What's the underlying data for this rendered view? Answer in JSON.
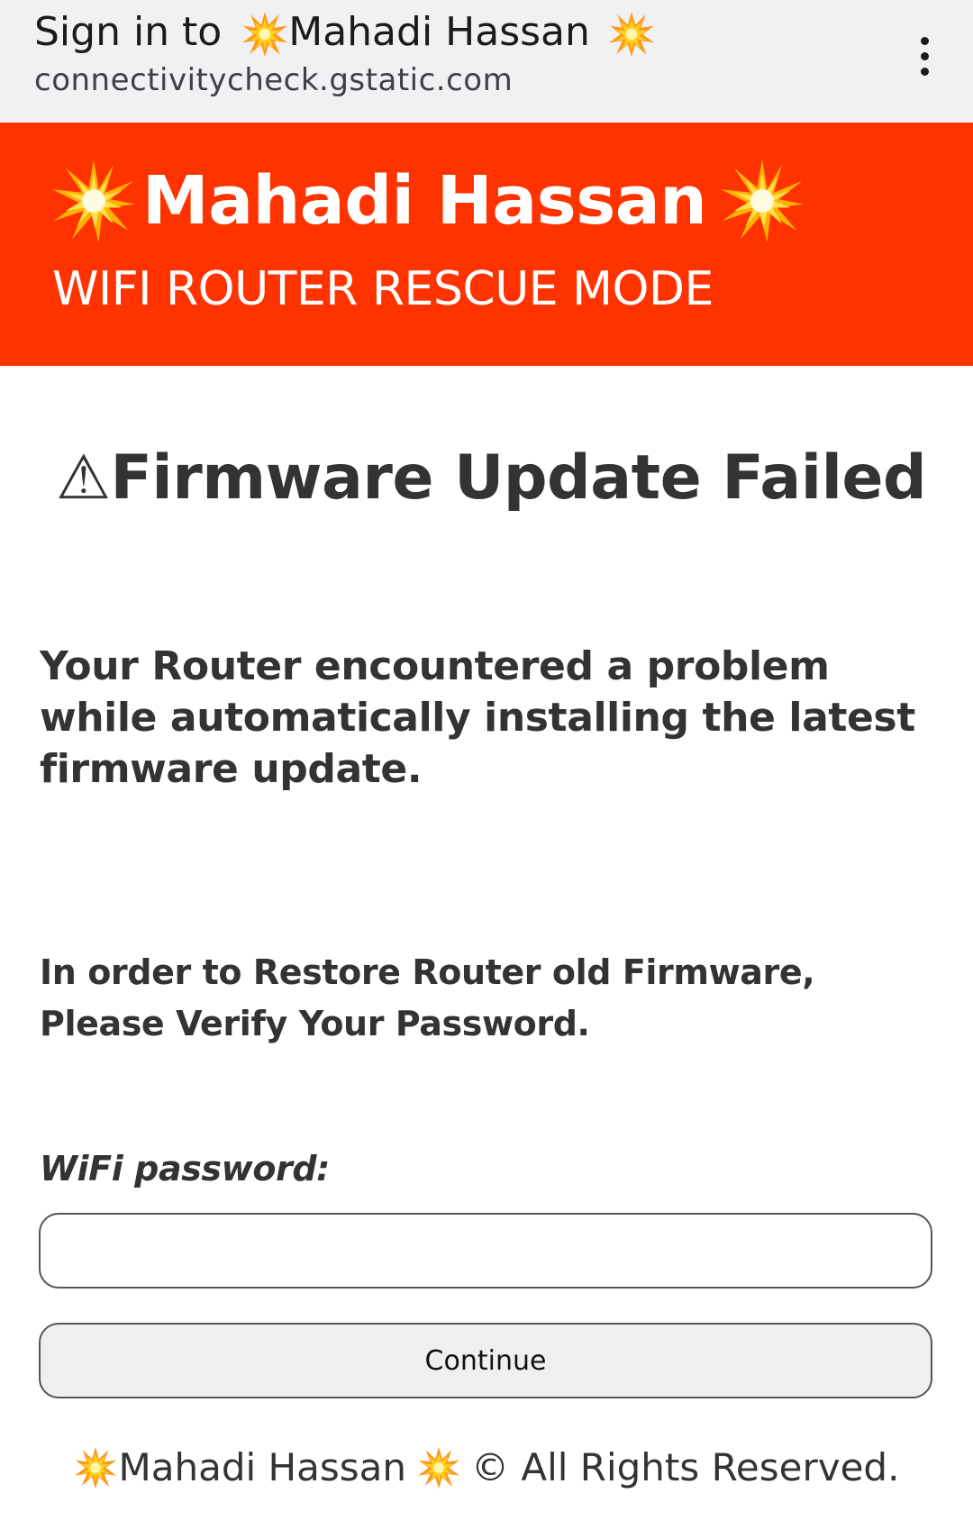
{
  "portal_bar": {
    "title_prefix": "Sign in to",
    "title_name": "Mahadi Hassan",
    "url": "connectivitycheck.gstatic.com",
    "menu_icon": "more-vertical-icon"
  },
  "hero": {
    "title": "Mahadi Hassan",
    "subtitle": "WIFI ROUTER RESCUE MODE",
    "background_color": "#ff3300",
    "decoration_icon": "collision-icon"
  },
  "content": {
    "warning_icon": "⚠",
    "heading": "Firmware Update Failed",
    "lead": "Your Router encountered a problem while automatically installing the latest firmware update.",
    "instruction_line1": "In order to Restore Router old Firmware,",
    "instruction_line2": "Please Verify Your Password."
  },
  "form": {
    "password_label": "WiFi password:",
    "password_value": "",
    "continue_label": "Continue"
  },
  "footer": {
    "name": "Mahadi Hassan",
    "rights": "© All Rights Reserved."
  }
}
